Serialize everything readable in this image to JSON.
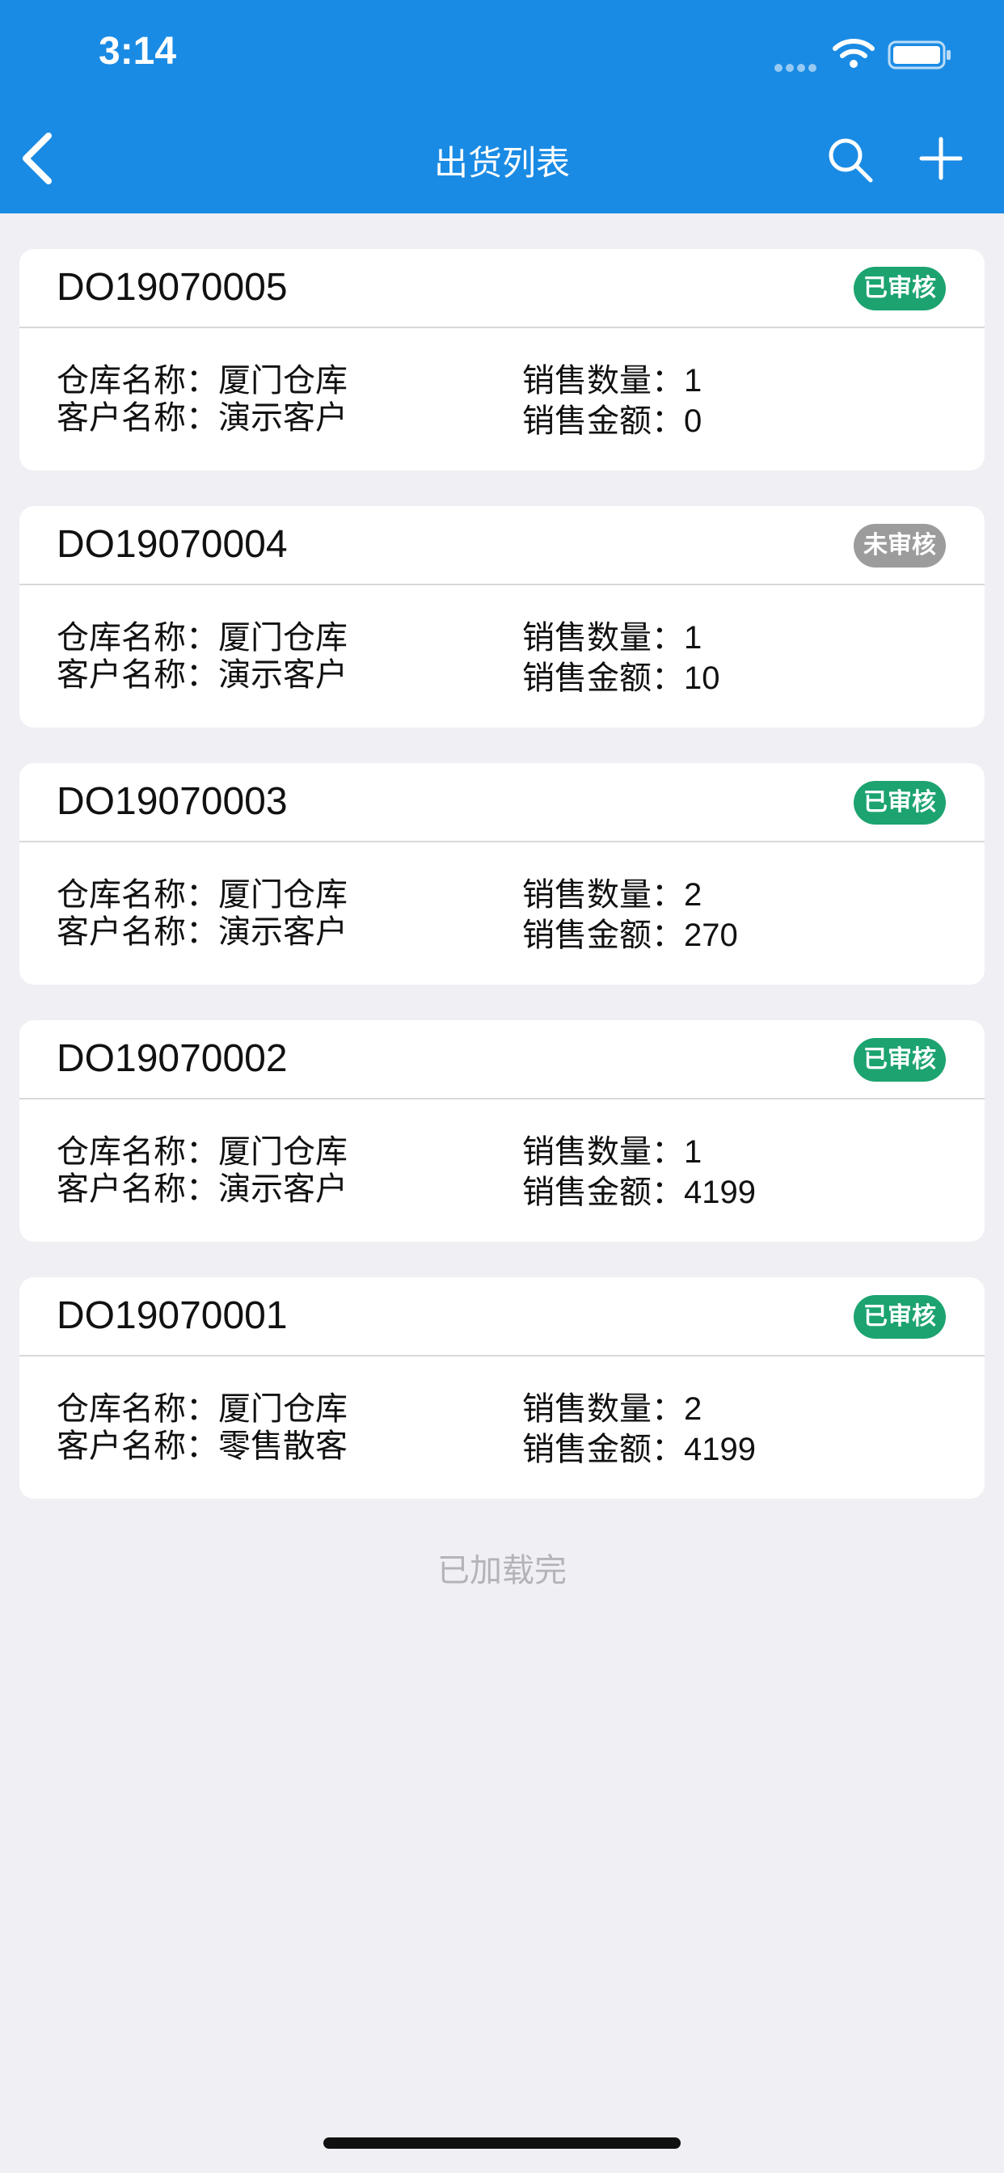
{
  "status_bar": {
    "time": "3:14"
  },
  "nav": {
    "title": "出货列表"
  },
  "labels": {
    "warehouse": "仓库名称：",
    "customer": "客户名称：",
    "quantity": "销售数量：",
    "amount": "销售金额："
  },
  "orders": [
    {
      "order_no": "DO19070005",
      "status": "已审核",
      "warehouse": "厦门仓库",
      "customer": "演示客户",
      "quantity": "1",
      "amount": "0"
    },
    {
      "order_no": "DO19070004",
      "status": "未审核",
      "warehouse": "厦门仓库",
      "customer": "演示客户",
      "quantity": "1",
      "amount": "10"
    },
    {
      "order_no": "DO19070003",
      "status": "已审核",
      "warehouse": "厦门仓库",
      "customer": "演示客户",
      "quantity": "2",
      "amount": "270"
    },
    {
      "order_no": "DO19070002",
      "status": "已审核",
      "warehouse": "厦门仓库",
      "customer": "演示客户",
      "quantity": "1",
      "amount": "4199"
    },
    {
      "order_no": "DO19070001",
      "status": "已审核",
      "warehouse": "厦门仓库",
      "customer": "零售散客",
      "quantity": "2",
      "amount": "4199"
    }
  ],
  "list_footer": "已加载完",
  "colors": {
    "header": "#1a8be4",
    "approved": "#1ca370",
    "pending": "#9c9c9c",
    "background": "#efeff4"
  }
}
